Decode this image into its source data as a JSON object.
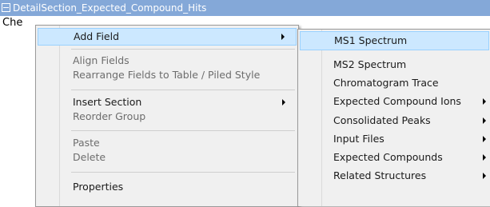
{
  "section": {
    "title": "DetailSection_Expected_Compound_Hits",
    "row_text": "Che"
  },
  "context_menu": {
    "add_field": "Add Field",
    "align_fields": "Align Fields",
    "rearrange": "Rearrange Fields to Table / Piled Style",
    "insert_section": "Insert Section",
    "reorder_group": "Reorder Group",
    "paste": "Paste",
    "delete": "Delete",
    "properties": "Properties"
  },
  "submenu": {
    "ms1": "MS1 Spectrum",
    "ms2": "MS2 Spectrum",
    "chromatogram": "Chromatogram Trace",
    "expected_ions": "Expected Compound Ions",
    "consolidated": "Consolidated Peaks",
    "input_files": "Input Files",
    "expected_compounds": "Expected Compounds",
    "related_structures": "Related Structures"
  },
  "colors": {
    "header_bg": "#84a8d8",
    "highlight": "#cce8ff",
    "menu_bg": "#f0f0f0"
  }
}
